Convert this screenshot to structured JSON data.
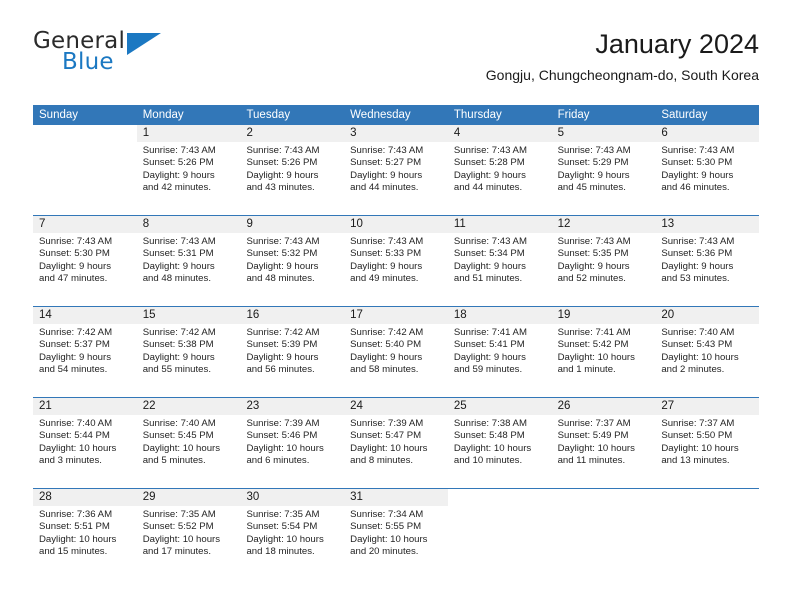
{
  "brand": {
    "name_top": "General",
    "name_bottom": "Blue",
    "accent_color": "#1b78c2",
    "text_color": "#2b2b2b"
  },
  "header": {
    "title": "January 2024",
    "subtitle": "Gongju, Chungcheongnam-do, South Korea"
  },
  "calendar": {
    "header_bg": "#3277b8",
    "header_text_color": "#ffffff",
    "daynum_band_bg": "#f0f0f0",
    "weekdays": [
      "Sunday",
      "Monday",
      "Tuesday",
      "Wednesday",
      "Thursday",
      "Friday",
      "Saturday"
    ],
    "weeks": [
      [
        {
          "day": "",
          "lines": []
        },
        {
          "day": "1",
          "lines": [
            "Sunrise: 7:43 AM",
            "Sunset: 5:26 PM",
            "Daylight: 9 hours",
            "and 42 minutes."
          ]
        },
        {
          "day": "2",
          "lines": [
            "Sunrise: 7:43 AM",
            "Sunset: 5:26 PM",
            "Daylight: 9 hours",
            "and 43 minutes."
          ]
        },
        {
          "day": "3",
          "lines": [
            "Sunrise: 7:43 AM",
            "Sunset: 5:27 PM",
            "Daylight: 9 hours",
            "and 44 minutes."
          ]
        },
        {
          "day": "4",
          "lines": [
            "Sunrise: 7:43 AM",
            "Sunset: 5:28 PM",
            "Daylight: 9 hours",
            "and 44 minutes."
          ]
        },
        {
          "day": "5",
          "lines": [
            "Sunrise: 7:43 AM",
            "Sunset: 5:29 PM",
            "Daylight: 9 hours",
            "and 45 minutes."
          ]
        },
        {
          "day": "6",
          "lines": [
            "Sunrise: 7:43 AM",
            "Sunset: 5:30 PM",
            "Daylight: 9 hours",
            "and 46 minutes."
          ]
        }
      ],
      [
        {
          "day": "7",
          "lines": [
            "Sunrise: 7:43 AM",
            "Sunset: 5:30 PM",
            "Daylight: 9 hours",
            "and 47 minutes."
          ]
        },
        {
          "day": "8",
          "lines": [
            "Sunrise: 7:43 AM",
            "Sunset: 5:31 PM",
            "Daylight: 9 hours",
            "and 48 minutes."
          ]
        },
        {
          "day": "9",
          "lines": [
            "Sunrise: 7:43 AM",
            "Sunset: 5:32 PM",
            "Daylight: 9 hours",
            "and 48 minutes."
          ]
        },
        {
          "day": "10",
          "lines": [
            "Sunrise: 7:43 AM",
            "Sunset: 5:33 PM",
            "Daylight: 9 hours",
            "and 49 minutes."
          ]
        },
        {
          "day": "11",
          "lines": [
            "Sunrise: 7:43 AM",
            "Sunset: 5:34 PM",
            "Daylight: 9 hours",
            "and 51 minutes."
          ]
        },
        {
          "day": "12",
          "lines": [
            "Sunrise: 7:43 AM",
            "Sunset: 5:35 PM",
            "Daylight: 9 hours",
            "and 52 minutes."
          ]
        },
        {
          "day": "13",
          "lines": [
            "Sunrise: 7:43 AM",
            "Sunset: 5:36 PM",
            "Daylight: 9 hours",
            "and 53 minutes."
          ]
        }
      ],
      [
        {
          "day": "14",
          "lines": [
            "Sunrise: 7:42 AM",
            "Sunset: 5:37 PM",
            "Daylight: 9 hours",
            "and 54 minutes."
          ]
        },
        {
          "day": "15",
          "lines": [
            "Sunrise: 7:42 AM",
            "Sunset: 5:38 PM",
            "Daylight: 9 hours",
            "and 55 minutes."
          ]
        },
        {
          "day": "16",
          "lines": [
            "Sunrise: 7:42 AM",
            "Sunset: 5:39 PM",
            "Daylight: 9 hours",
            "and 56 minutes."
          ]
        },
        {
          "day": "17",
          "lines": [
            "Sunrise: 7:42 AM",
            "Sunset: 5:40 PM",
            "Daylight: 9 hours",
            "and 58 minutes."
          ]
        },
        {
          "day": "18",
          "lines": [
            "Sunrise: 7:41 AM",
            "Sunset: 5:41 PM",
            "Daylight: 9 hours",
            "and 59 minutes."
          ]
        },
        {
          "day": "19",
          "lines": [
            "Sunrise: 7:41 AM",
            "Sunset: 5:42 PM",
            "Daylight: 10 hours",
            "and 1 minute."
          ]
        },
        {
          "day": "20",
          "lines": [
            "Sunrise: 7:40 AM",
            "Sunset: 5:43 PM",
            "Daylight: 10 hours",
            "and 2 minutes."
          ]
        }
      ],
      [
        {
          "day": "21",
          "lines": [
            "Sunrise: 7:40 AM",
            "Sunset: 5:44 PM",
            "Daylight: 10 hours",
            "and 3 minutes."
          ]
        },
        {
          "day": "22",
          "lines": [
            "Sunrise: 7:40 AM",
            "Sunset: 5:45 PM",
            "Daylight: 10 hours",
            "and 5 minutes."
          ]
        },
        {
          "day": "23",
          "lines": [
            "Sunrise: 7:39 AM",
            "Sunset: 5:46 PM",
            "Daylight: 10 hours",
            "and 6 minutes."
          ]
        },
        {
          "day": "24",
          "lines": [
            "Sunrise: 7:39 AM",
            "Sunset: 5:47 PM",
            "Daylight: 10 hours",
            "and 8 minutes."
          ]
        },
        {
          "day": "25",
          "lines": [
            "Sunrise: 7:38 AM",
            "Sunset: 5:48 PM",
            "Daylight: 10 hours",
            "and 10 minutes."
          ]
        },
        {
          "day": "26",
          "lines": [
            "Sunrise: 7:37 AM",
            "Sunset: 5:49 PM",
            "Daylight: 10 hours",
            "and 11 minutes."
          ]
        },
        {
          "day": "27",
          "lines": [
            "Sunrise: 7:37 AM",
            "Sunset: 5:50 PM",
            "Daylight: 10 hours",
            "and 13 minutes."
          ]
        }
      ],
      [
        {
          "day": "28",
          "lines": [
            "Sunrise: 7:36 AM",
            "Sunset: 5:51 PM",
            "Daylight: 10 hours",
            "and 15 minutes."
          ]
        },
        {
          "day": "29",
          "lines": [
            "Sunrise: 7:35 AM",
            "Sunset: 5:52 PM",
            "Daylight: 10 hours",
            "and 17 minutes."
          ]
        },
        {
          "day": "30",
          "lines": [
            "Sunrise: 7:35 AM",
            "Sunset: 5:54 PM",
            "Daylight: 10 hours",
            "and 18 minutes."
          ]
        },
        {
          "day": "31",
          "lines": [
            "Sunrise: 7:34 AM",
            "Sunset: 5:55 PM",
            "Daylight: 10 hours",
            "and 20 minutes."
          ]
        },
        {
          "day": "",
          "lines": []
        },
        {
          "day": "",
          "lines": []
        },
        {
          "day": "",
          "lines": []
        }
      ]
    ]
  }
}
